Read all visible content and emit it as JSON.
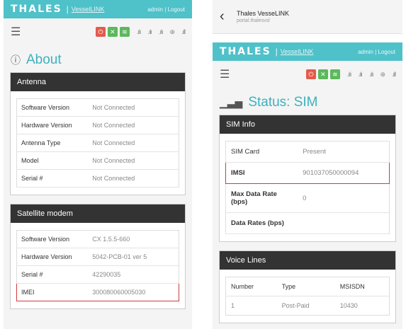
{
  "left": {
    "brand": {
      "logo": "THALES",
      "sub": "VesselLINK",
      "user": "admin | Logout"
    },
    "title": "About",
    "antenna": {
      "heading": "Antenna",
      "rows": [
        {
          "key": "Software Version",
          "value": "Not Connected"
        },
        {
          "key": "Hardware Version",
          "value": "Not Connected"
        },
        {
          "key": "Antenna Type",
          "value": "Not Connected"
        },
        {
          "key": "Model",
          "value": "Not Connected"
        },
        {
          "key": "Serial #",
          "value": "Not Connected"
        }
      ]
    },
    "modem": {
      "heading": "Satellite modem",
      "rows": [
        {
          "key": "Software Version",
          "value": "CX 1.5.5-660"
        },
        {
          "key": "Hardware Version",
          "value": "5042-PCB-01 ver 5"
        },
        {
          "key": "Serial #",
          "value": "42290035"
        },
        {
          "key": "IMEI",
          "value": "300080060005030"
        }
      ]
    }
  },
  "right": {
    "topbar": {
      "title": "Thales VesseLINK",
      "subtitle": "portal.thalesvsl"
    },
    "brand": {
      "logo": "THALES",
      "sub": "VesselLINK",
      "user": "admin | Logout"
    },
    "title": "Status: SIM",
    "sim": {
      "heading": "SIM Info",
      "rows": [
        {
          "key": "SIM Card",
          "value": "Present"
        },
        {
          "key": "IMSI",
          "value": "901037050000094"
        },
        {
          "key": "Max Data Rate (bps)",
          "value": "0"
        },
        {
          "key": "Data Rates (bps)",
          "value": ""
        }
      ]
    },
    "voice": {
      "heading": "Voice Lines",
      "columns": [
        "Number",
        "Type",
        "MSISDN"
      ],
      "rows": [
        {
          "number": "1",
          "type": "Post-Paid",
          "msisdn": "10430"
        }
      ]
    }
  },
  "colors": {
    "accent": "#4fc1c9",
    "title": "#3cb2bd",
    "panel_head": "#333333",
    "highlight": "#d23b3b"
  }
}
